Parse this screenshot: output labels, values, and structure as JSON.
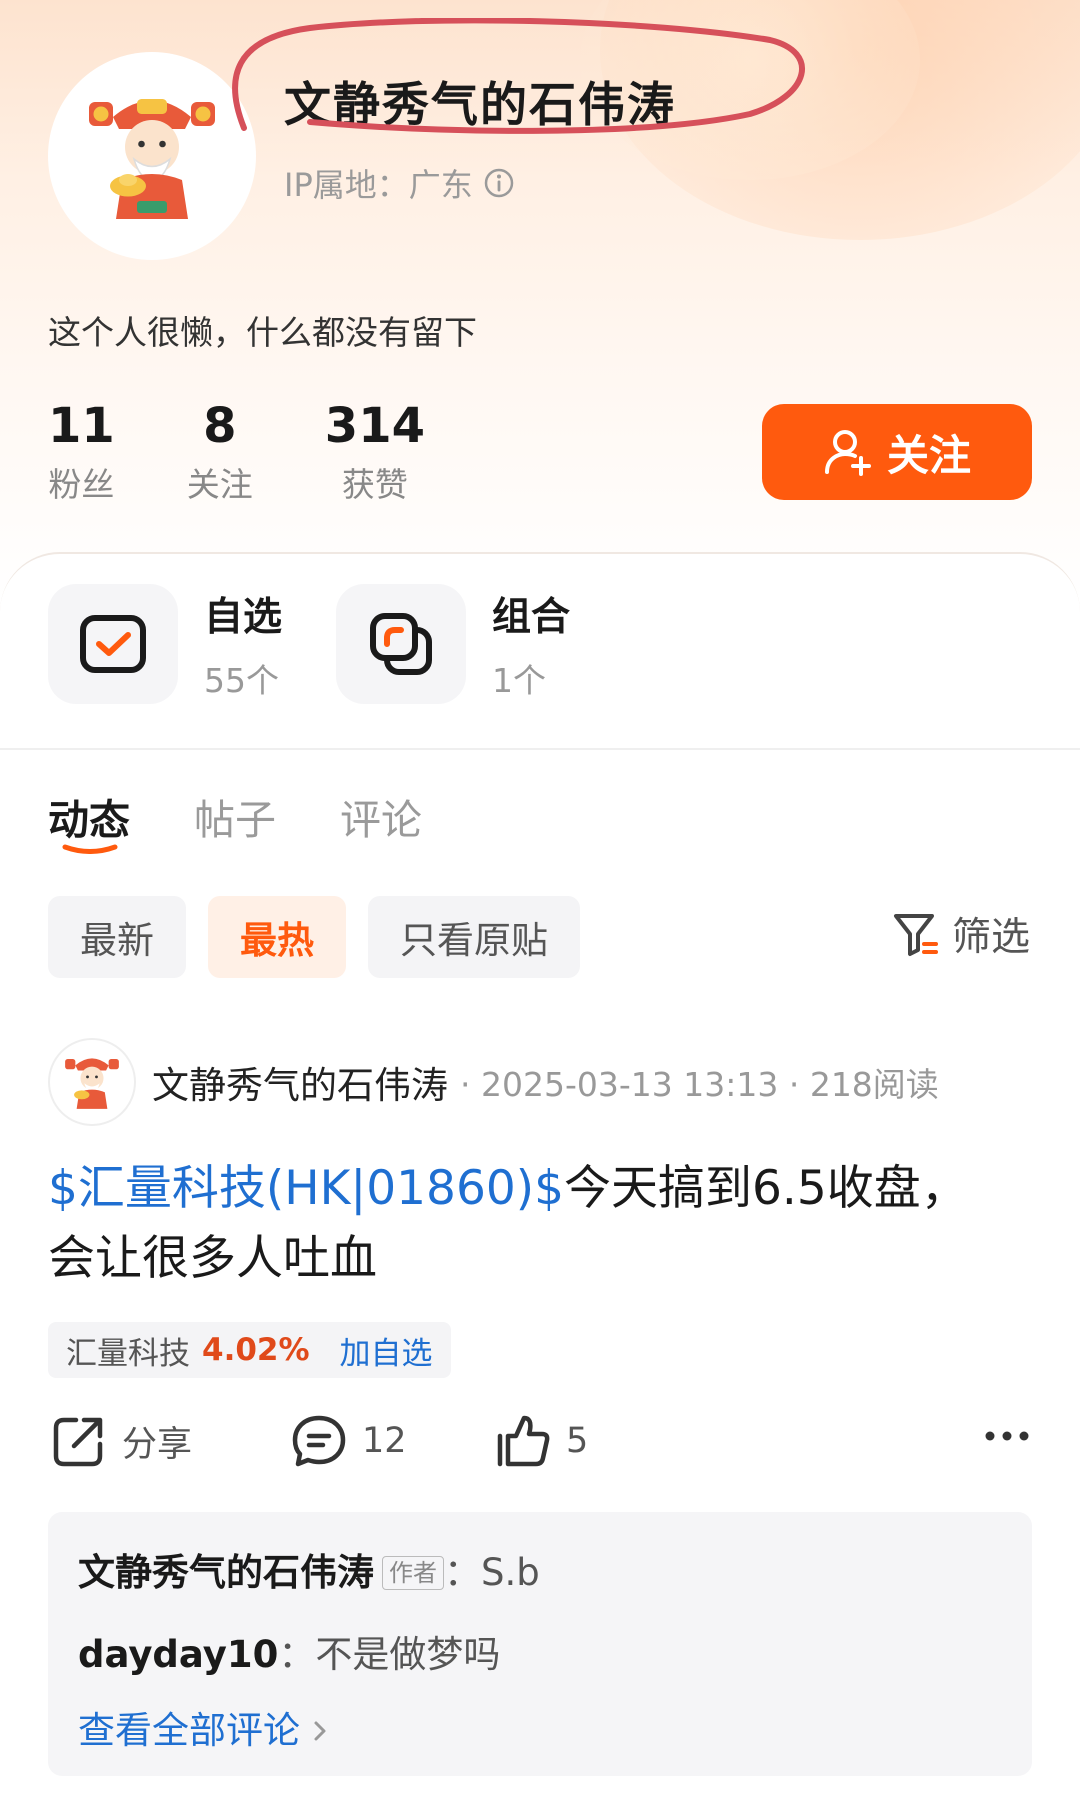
{
  "profile": {
    "username": "文静秀气的石伟涛",
    "ip_location": "IP属地：广东",
    "bio": "这个人很懒，什么都没有留下",
    "stats": [
      {
        "value": "11",
        "label": "粉丝"
      },
      {
        "value": "8",
        "label": "关注"
      },
      {
        "value": "314",
        "label": "获赞"
      }
    ],
    "follow_label": "关注"
  },
  "quick": {
    "watchlist": {
      "title": "自选",
      "count": "55个"
    },
    "portfolio": {
      "title": "组合",
      "count": "1个"
    }
  },
  "tabs": [
    "动态",
    "帖子",
    "评论"
  ],
  "filters": {
    "chips": [
      "最新",
      "最热",
      "只看原贴"
    ],
    "filter_label": "筛选"
  },
  "post": {
    "author": "文静秀气的石伟涛",
    "meta": "· 2025-03-13 13:13 · 218阅读",
    "stock_link": "$汇量科技(HK|01860)$",
    "text_part1": "今天搞到6.5收盘，",
    "text_part2": "会让很多人吐血",
    "stock_tag": {
      "name": "汇量科技",
      "change": "4.02%",
      "add": "加自选"
    },
    "actions": {
      "share": "分享",
      "comments": "12",
      "likes": "5"
    },
    "comments": [
      {
        "user": "文静秀气的石伟涛",
        "badge": "作者",
        "text": "S.b"
      },
      {
        "user": "dayday10",
        "text": "不是做梦吗"
      }
    ],
    "view_all": "查看全部评论"
  },
  "colors": {
    "accent": "#ff5a0e",
    "link": "#1f6fd1",
    "gain": "#e04a1a",
    "annotation": "#d6505a"
  }
}
